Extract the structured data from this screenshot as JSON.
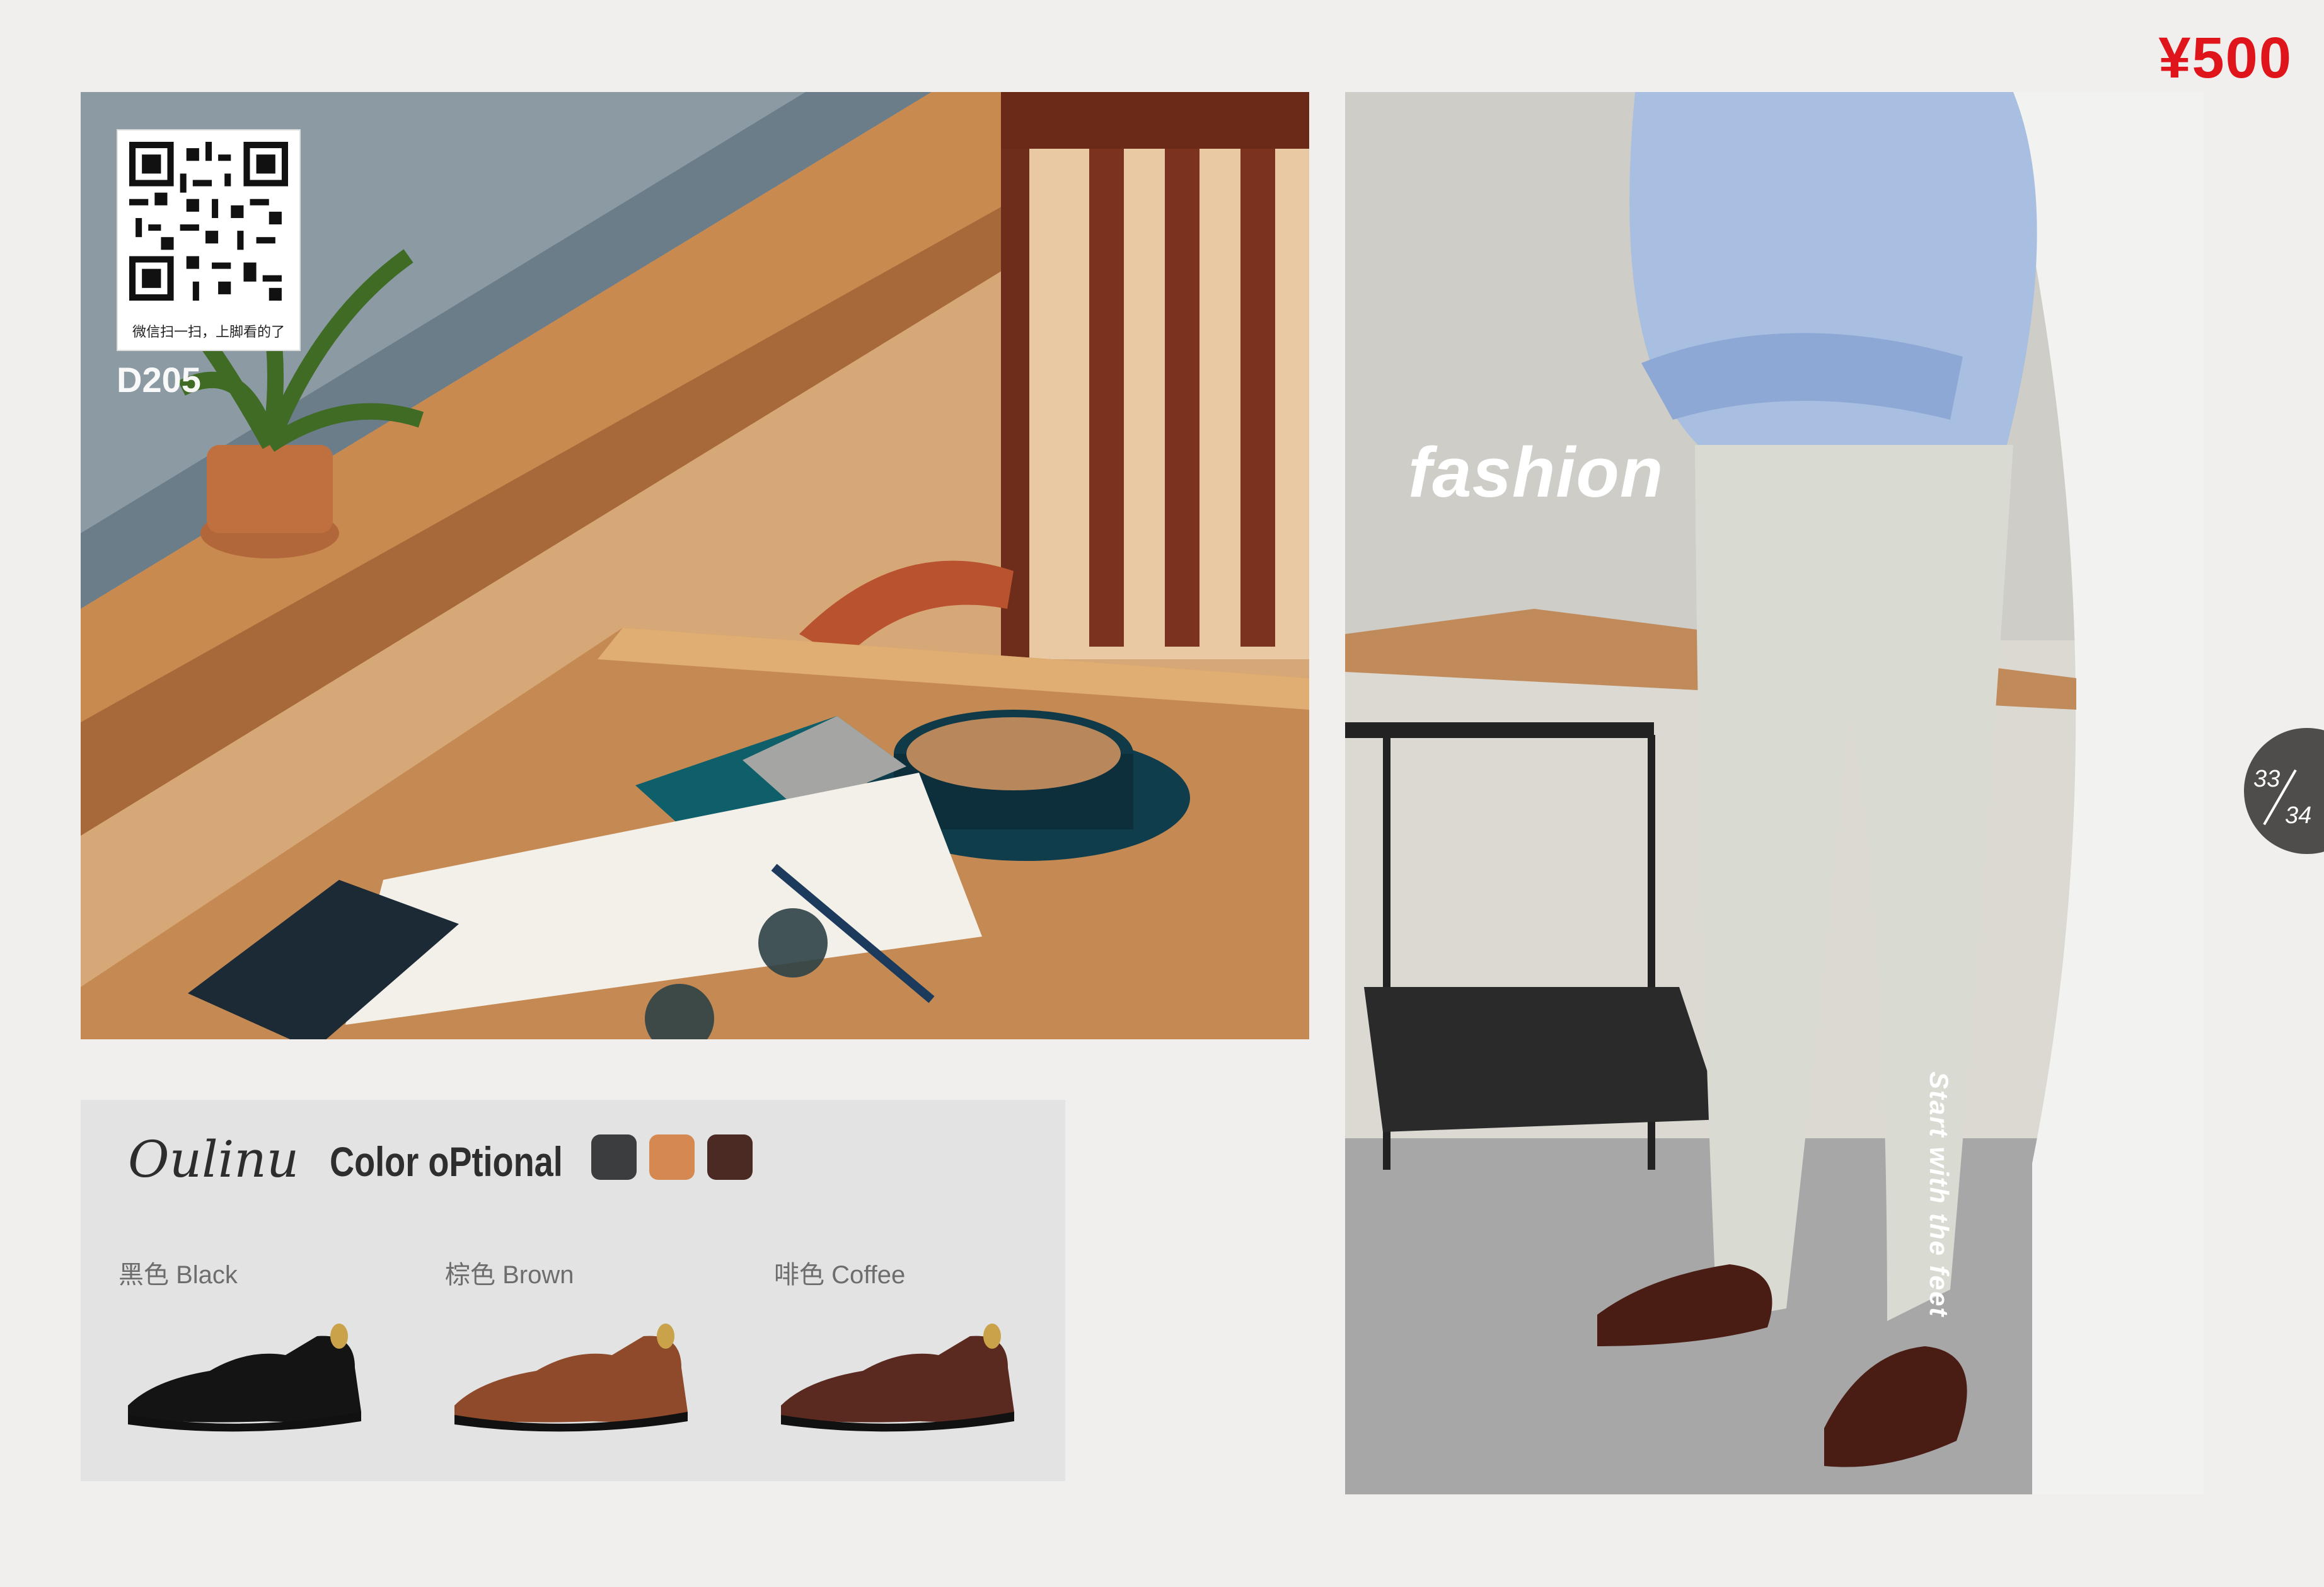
{
  "price": "¥500",
  "qr": {
    "caption": "微信扫一扫，上脚看的了"
  },
  "product_code": "D205",
  "hero_word": "fashion",
  "vertical_tagline": "Start with the feet",
  "pagination": {
    "current": "33",
    "total": "34"
  },
  "color_panel": {
    "brand": "Oulinu",
    "title": "Color oPtional",
    "swatches": [
      "#3c3d3e",
      "#d5884f",
      "#4a2a22"
    ],
    "options": [
      {
        "label": "黑色 Black",
        "color": "#141414"
      },
      {
        "label": "棕色 Brown",
        "color": "#8e4a2b"
      },
      {
        "label": "啡色 Coffee",
        "color": "#5a2a20"
      }
    ]
  }
}
